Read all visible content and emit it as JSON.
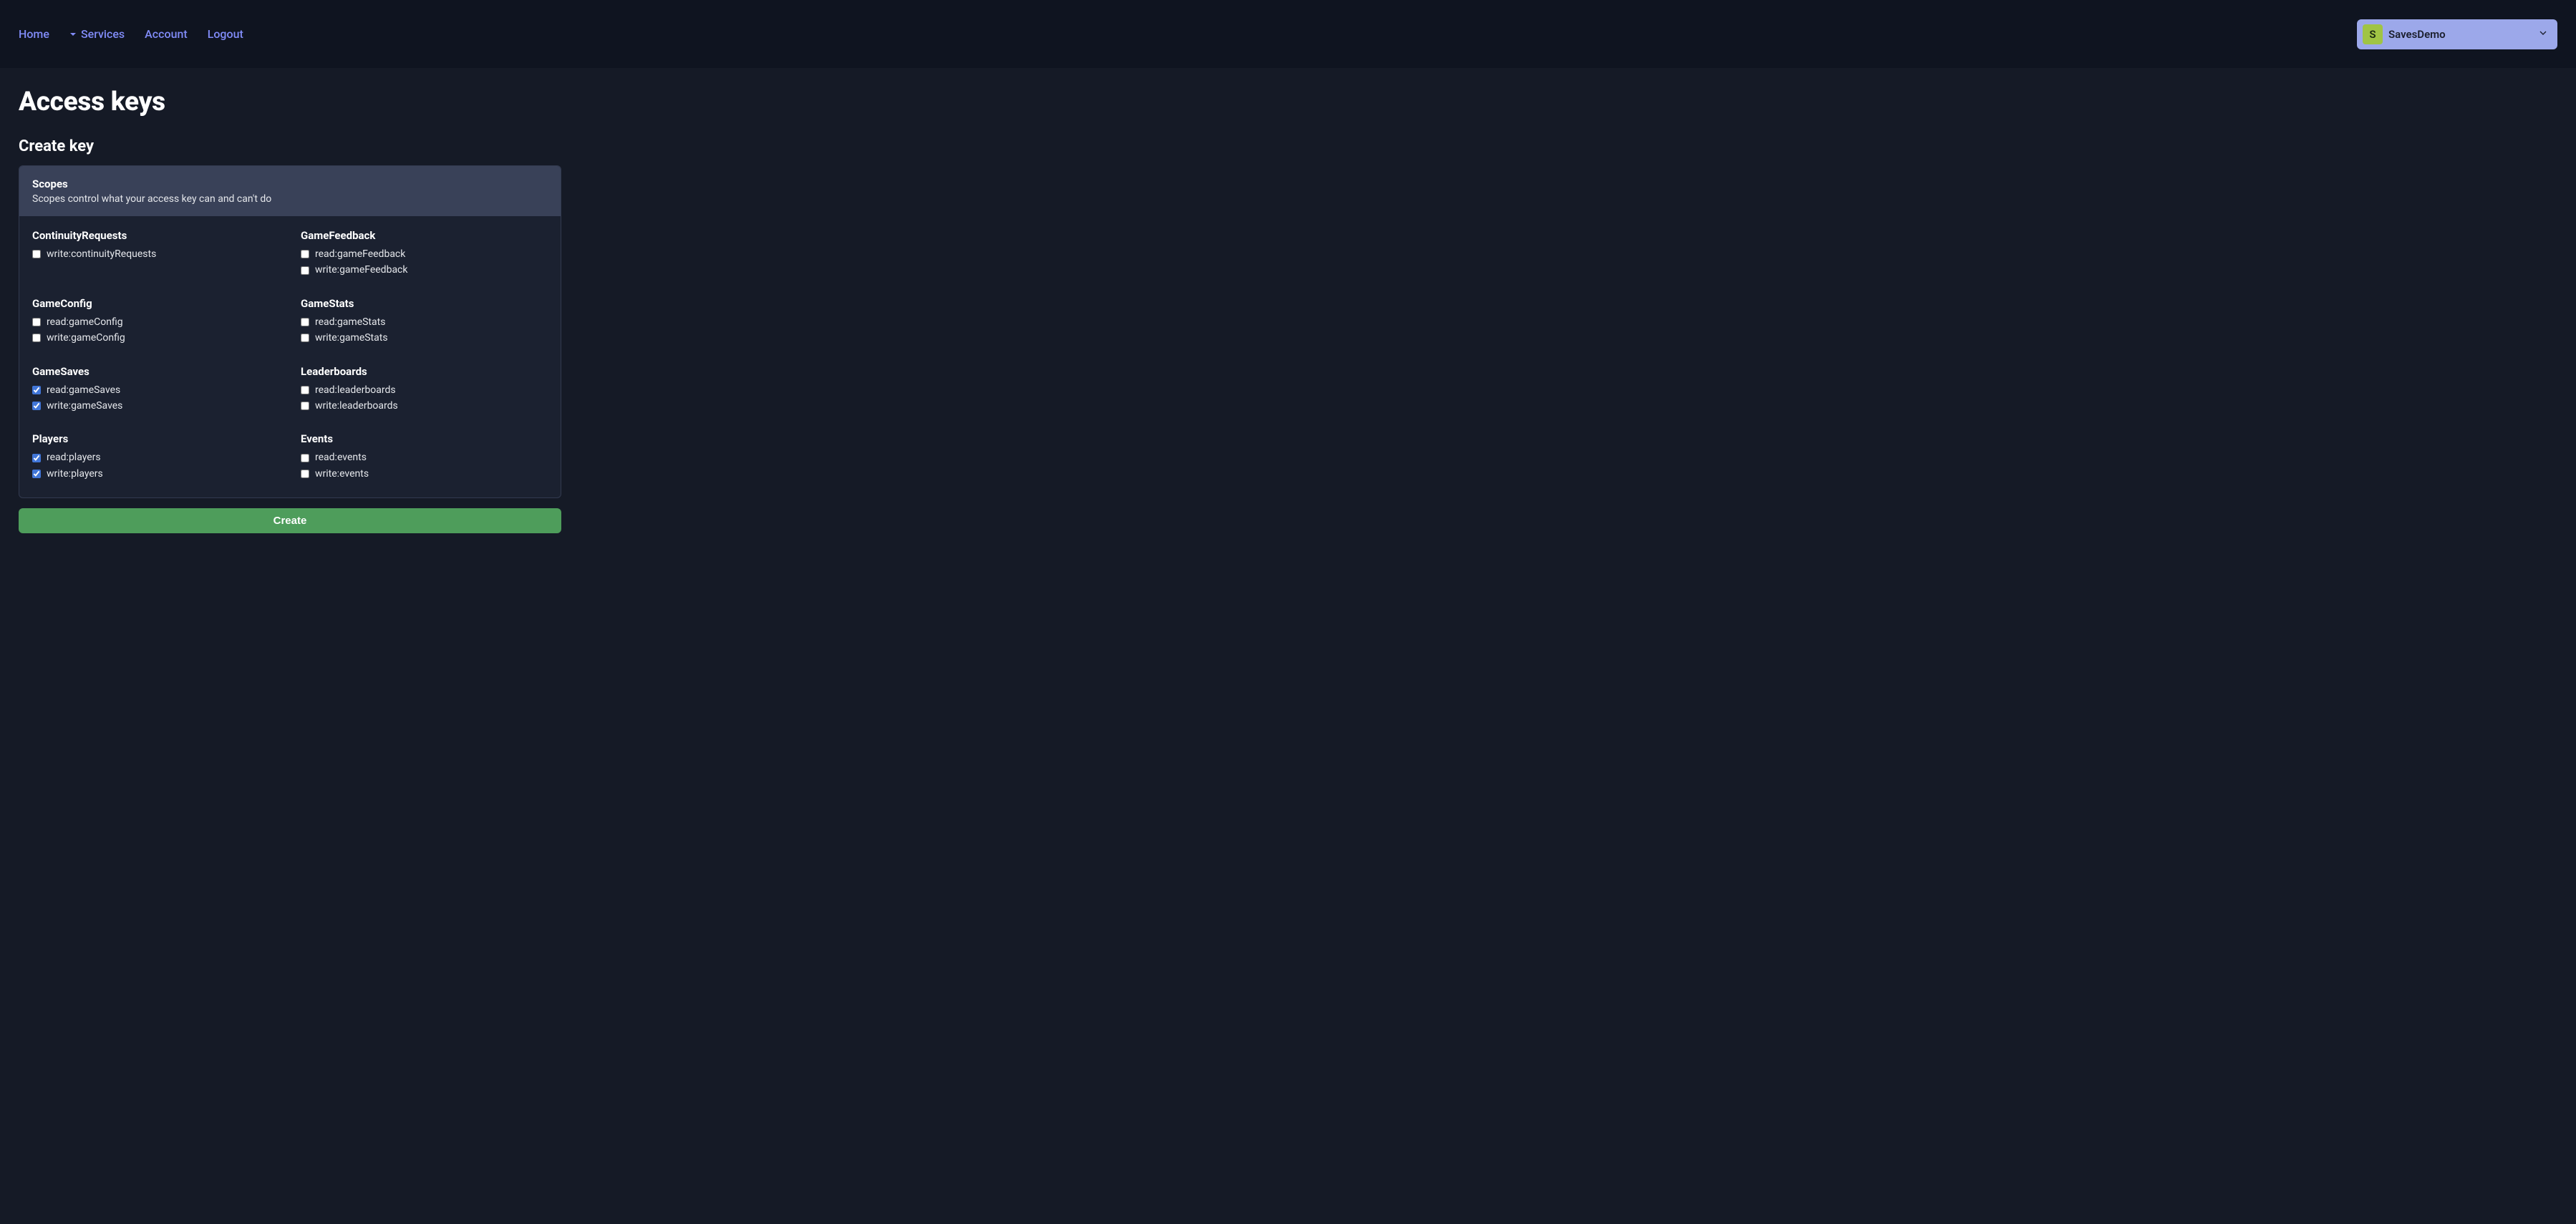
{
  "nav": {
    "home": "Home",
    "services": "Services",
    "account": "Account",
    "logout": "Logout"
  },
  "project": {
    "initial": "S",
    "name": "SavesDemo"
  },
  "page": {
    "title": "Access keys",
    "section": "Create key",
    "scopes_heading": "Scopes",
    "scopes_desc": "Scopes control what your access key can and can't do",
    "create_button": "Create"
  },
  "scope_groups": [
    {
      "title": "ContinuityRequests",
      "scopes": [
        {
          "label": "write:continuityRequests",
          "checked": false
        }
      ]
    },
    {
      "title": "GameFeedback",
      "scopes": [
        {
          "label": "read:gameFeedback",
          "checked": false
        },
        {
          "label": "write:gameFeedback",
          "checked": false
        }
      ]
    },
    {
      "title": "GameConfig",
      "scopes": [
        {
          "label": "read:gameConfig",
          "checked": false
        },
        {
          "label": "write:gameConfig",
          "checked": false
        }
      ]
    },
    {
      "title": "GameStats",
      "scopes": [
        {
          "label": "read:gameStats",
          "checked": false
        },
        {
          "label": "write:gameStats",
          "checked": false
        }
      ]
    },
    {
      "title": "GameSaves",
      "scopes": [
        {
          "label": "read:gameSaves",
          "checked": true
        },
        {
          "label": "write:gameSaves",
          "checked": true
        }
      ]
    },
    {
      "title": "Leaderboards",
      "scopes": [
        {
          "label": "read:leaderboards",
          "checked": false
        },
        {
          "label": "write:leaderboards",
          "checked": false
        }
      ]
    },
    {
      "title": "Players",
      "scopes": [
        {
          "label": "read:players",
          "checked": true
        },
        {
          "label": "write:players",
          "checked": true
        }
      ]
    },
    {
      "title": "Events",
      "scopes": [
        {
          "label": "read:events",
          "checked": false
        },
        {
          "label": "write:events",
          "checked": false
        }
      ]
    }
  ]
}
